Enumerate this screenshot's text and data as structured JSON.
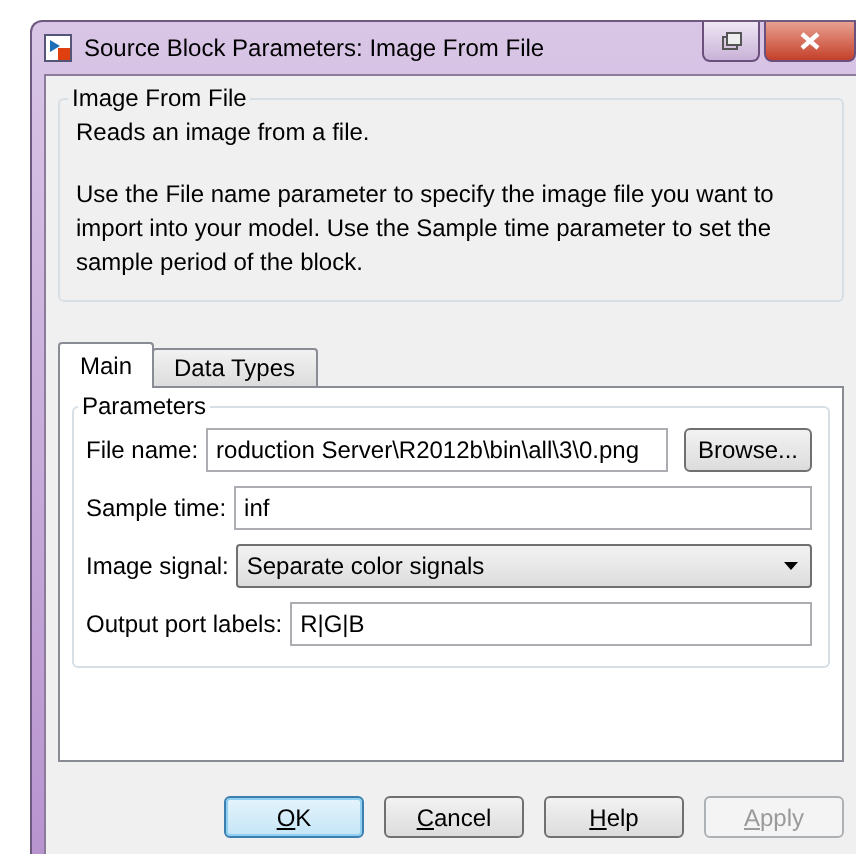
{
  "window": {
    "title": "Source Block Parameters: Image From File"
  },
  "description": {
    "title": "Image From File",
    "lines": [
      "Reads an image from a file.",
      "Use the File name parameter to specify the image file you want to import into your model. Use the Sample time parameter to set the sample period of the block."
    ]
  },
  "tabs": [
    {
      "label": "Main",
      "selected": true
    },
    {
      "label": "Data Types",
      "selected": false
    }
  ],
  "parameters": {
    "title": "Parameters",
    "fields": [
      {
        "kind": "file",
        "label": "File name:",
        "value": "roduction Server\\R2012b\\bin\\all\\3\\0.png",
        "button": "Browse..."
      },
      {
        "kind": "text",
        "label": "Sample time:",
        "value": "inf"
      },
      {
        "kind": "select",
        "label": "Image signal:",
        "value": "Separate color signals"
      },
      {
        "kind": "text",
        "label": "Output port labels:",
        "value": "R|G|B"
      }
    ]
  },
  "buttons": [
    {
      "label": "OK",
      "default": true,
      "disabled": false
    },
    {
      "label": "Cancel",
      "default": false,
      "disabled": false
    },
    {
      "label": "Help",
      "default": false,
      "disabled": false
    },
    {
      "label": "Apply",
      "default": false,
      "disabled": true
    }
  ]
}
